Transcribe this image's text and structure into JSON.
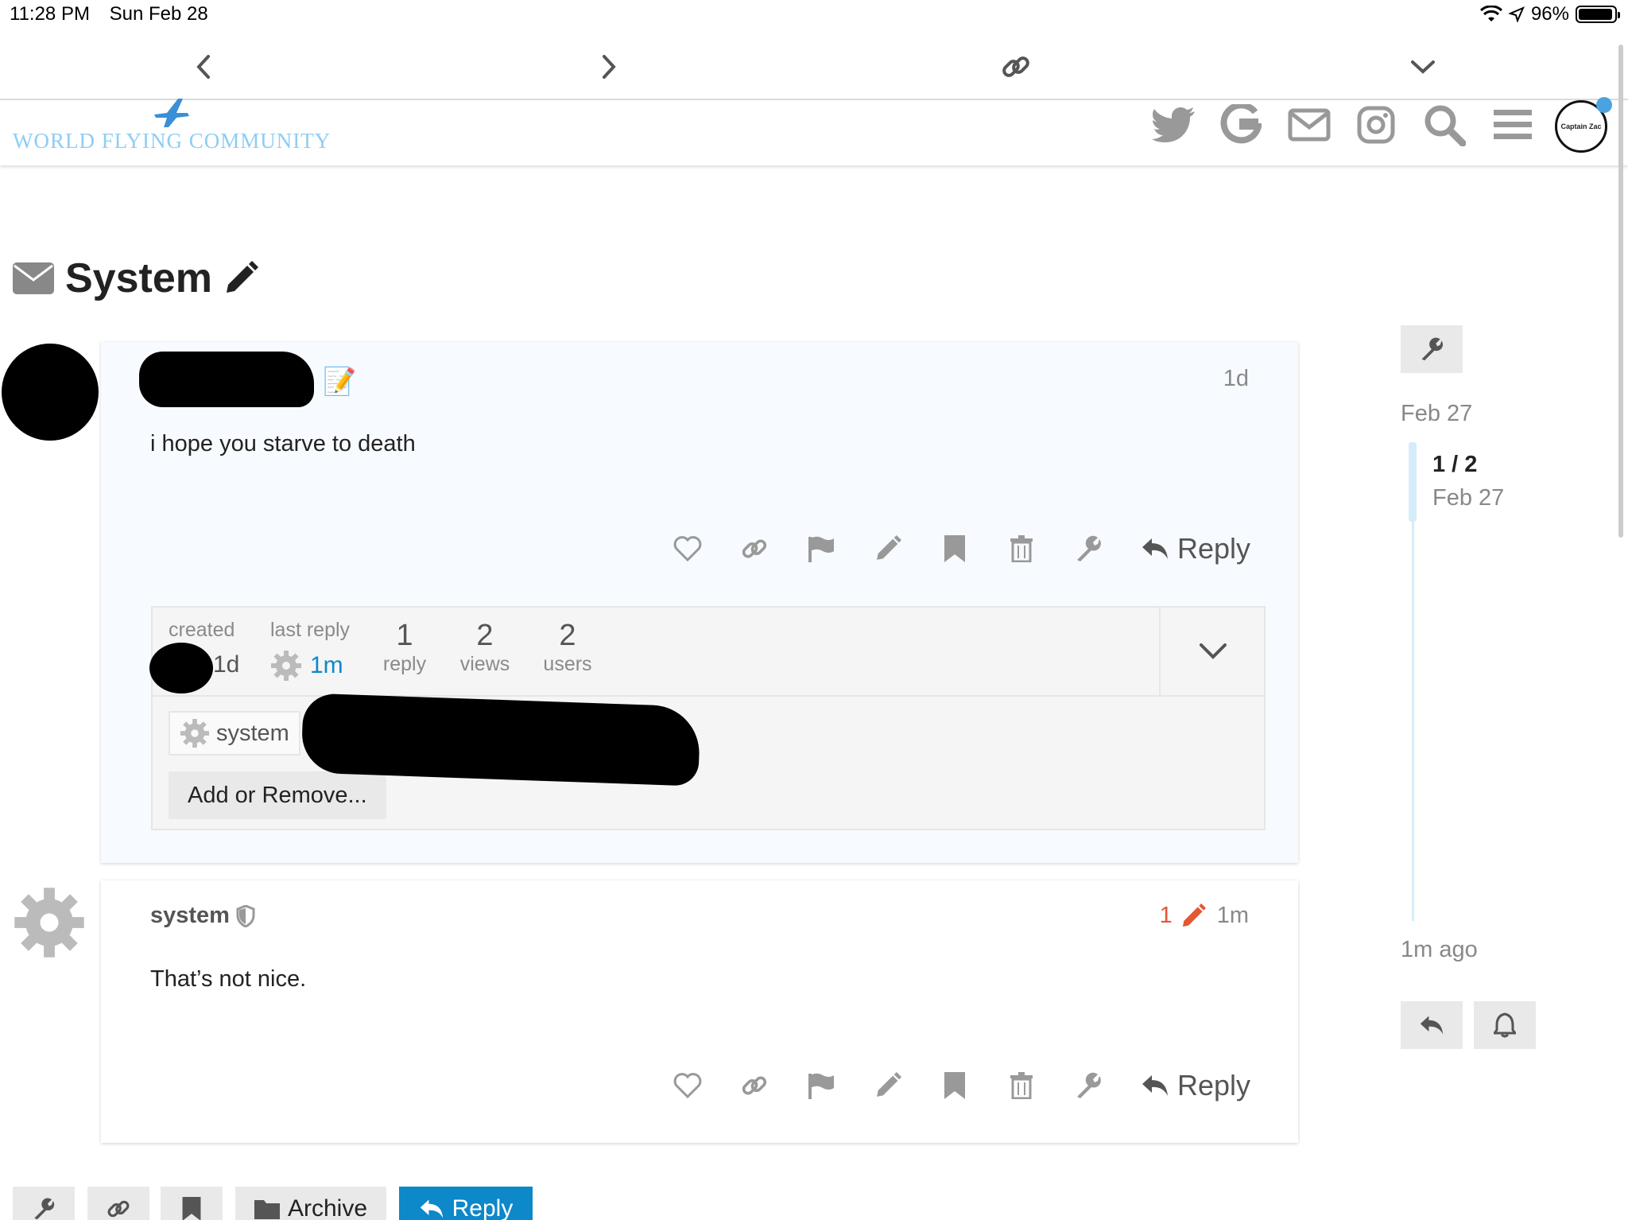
{
  "status_bar": {
    "time": "11:28 PM",
    "date": "Sun Feb 28",
    "battery": "96%",
    "battery_level": 0.96
  },
  "toolbar": {
    "icons": [
      "chevron-left-icon",
      "chevron-right-icon",
      "link-icon",
      "chevron-down-icon"
    ]
  },
  "header": {
    "logo_text": "WORLD FLYING COMMUNITY",
    "avatar_text": "Captain Zac",
    "icons": [
      "twitter-icon",
      "google-icon",
      "mail-icon",
      "instagram-icon",
      "search-icon",
      "menu-icon"
    ]
  },
  "topic": {
    "title": "System"
  },
  "posts": [
    {
      "time": "1d",
      "body": "i hope you starve to death",
      "reply_label": "Reply"
    },
    {
      "username": "system",
      "edit_count": "1",
      "time": "1m",
      "body": "That’s not nice.",
      "reply_label": "Reply"
    }
  ],
  "topic_map": {
    "created_label": "created",
    "created_value": "1d",
    "last_reply_label": "last reply",
    "last_reply_value": "1m",
    "replies_num": "1",
    "replies_label": "reply",
    "views_num": "2",
    "views_label": "views",
    "users_num": "2",
    "users_label": "users",
    "participant": "system",
    "add_remove_label": "Add or Remove..."
  },
  "timeline": {
    "start_date": "Feb 27",
    "position": "1 / 2",
    "position_date": "Feb 27",
    "end_label": "1m ago"
  },
  "footer": {
    "archive_label": "Archive",
    "reply_label": "Reply"
  },
  "colors": {
    "accent_blue": "#0d88c9",
    "edit_orange": "#e45735",
    "logo_blue": "#8ecdf4"
  }
}
